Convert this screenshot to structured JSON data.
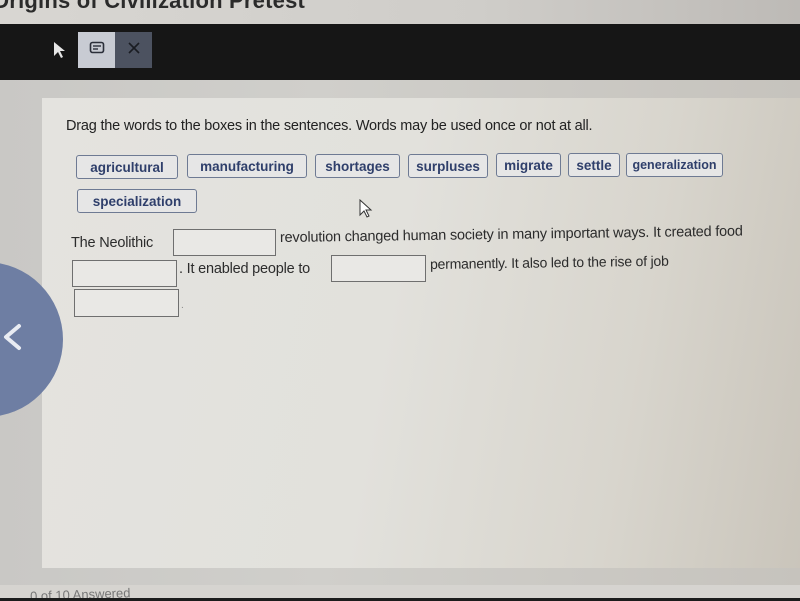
{
  "header": {
    "title": "Origins of Civilization Pretest"
  },
  "toolbar": {
    "pointer_icon": "arrow-pointer-icon",
    "note_icon": "note-icon",
    "close_icon": "close-icon"
  },
  "question": {
    "instructions": "Drag the words to the boxes in the sentences. Words may be used once or not at all.",
    "word_bank": [
      "agricultural",
      "manufacturing",
      "shortages",
      "surpluses",
      "migrate",
      "settle",
      "generalization",
      "specialization"
    ],
    "sentence_parts": {
      "part1": "The Neolithic",
      "part2": "revolution changed human society in many important ways. It created food",
      "part3": ". It enabled people to",
      "part4": "permanently. It also led to the rise of job",
      "part5": "."
    },
    "blanks": [
      "",
      "",
      "",
      ""
    ]
  },
  "navigation": {
    "back_icon": "chevron-left-icon"
  },
  "status": {
    "answered_text": "0 of 10 Answered"
  }
}
